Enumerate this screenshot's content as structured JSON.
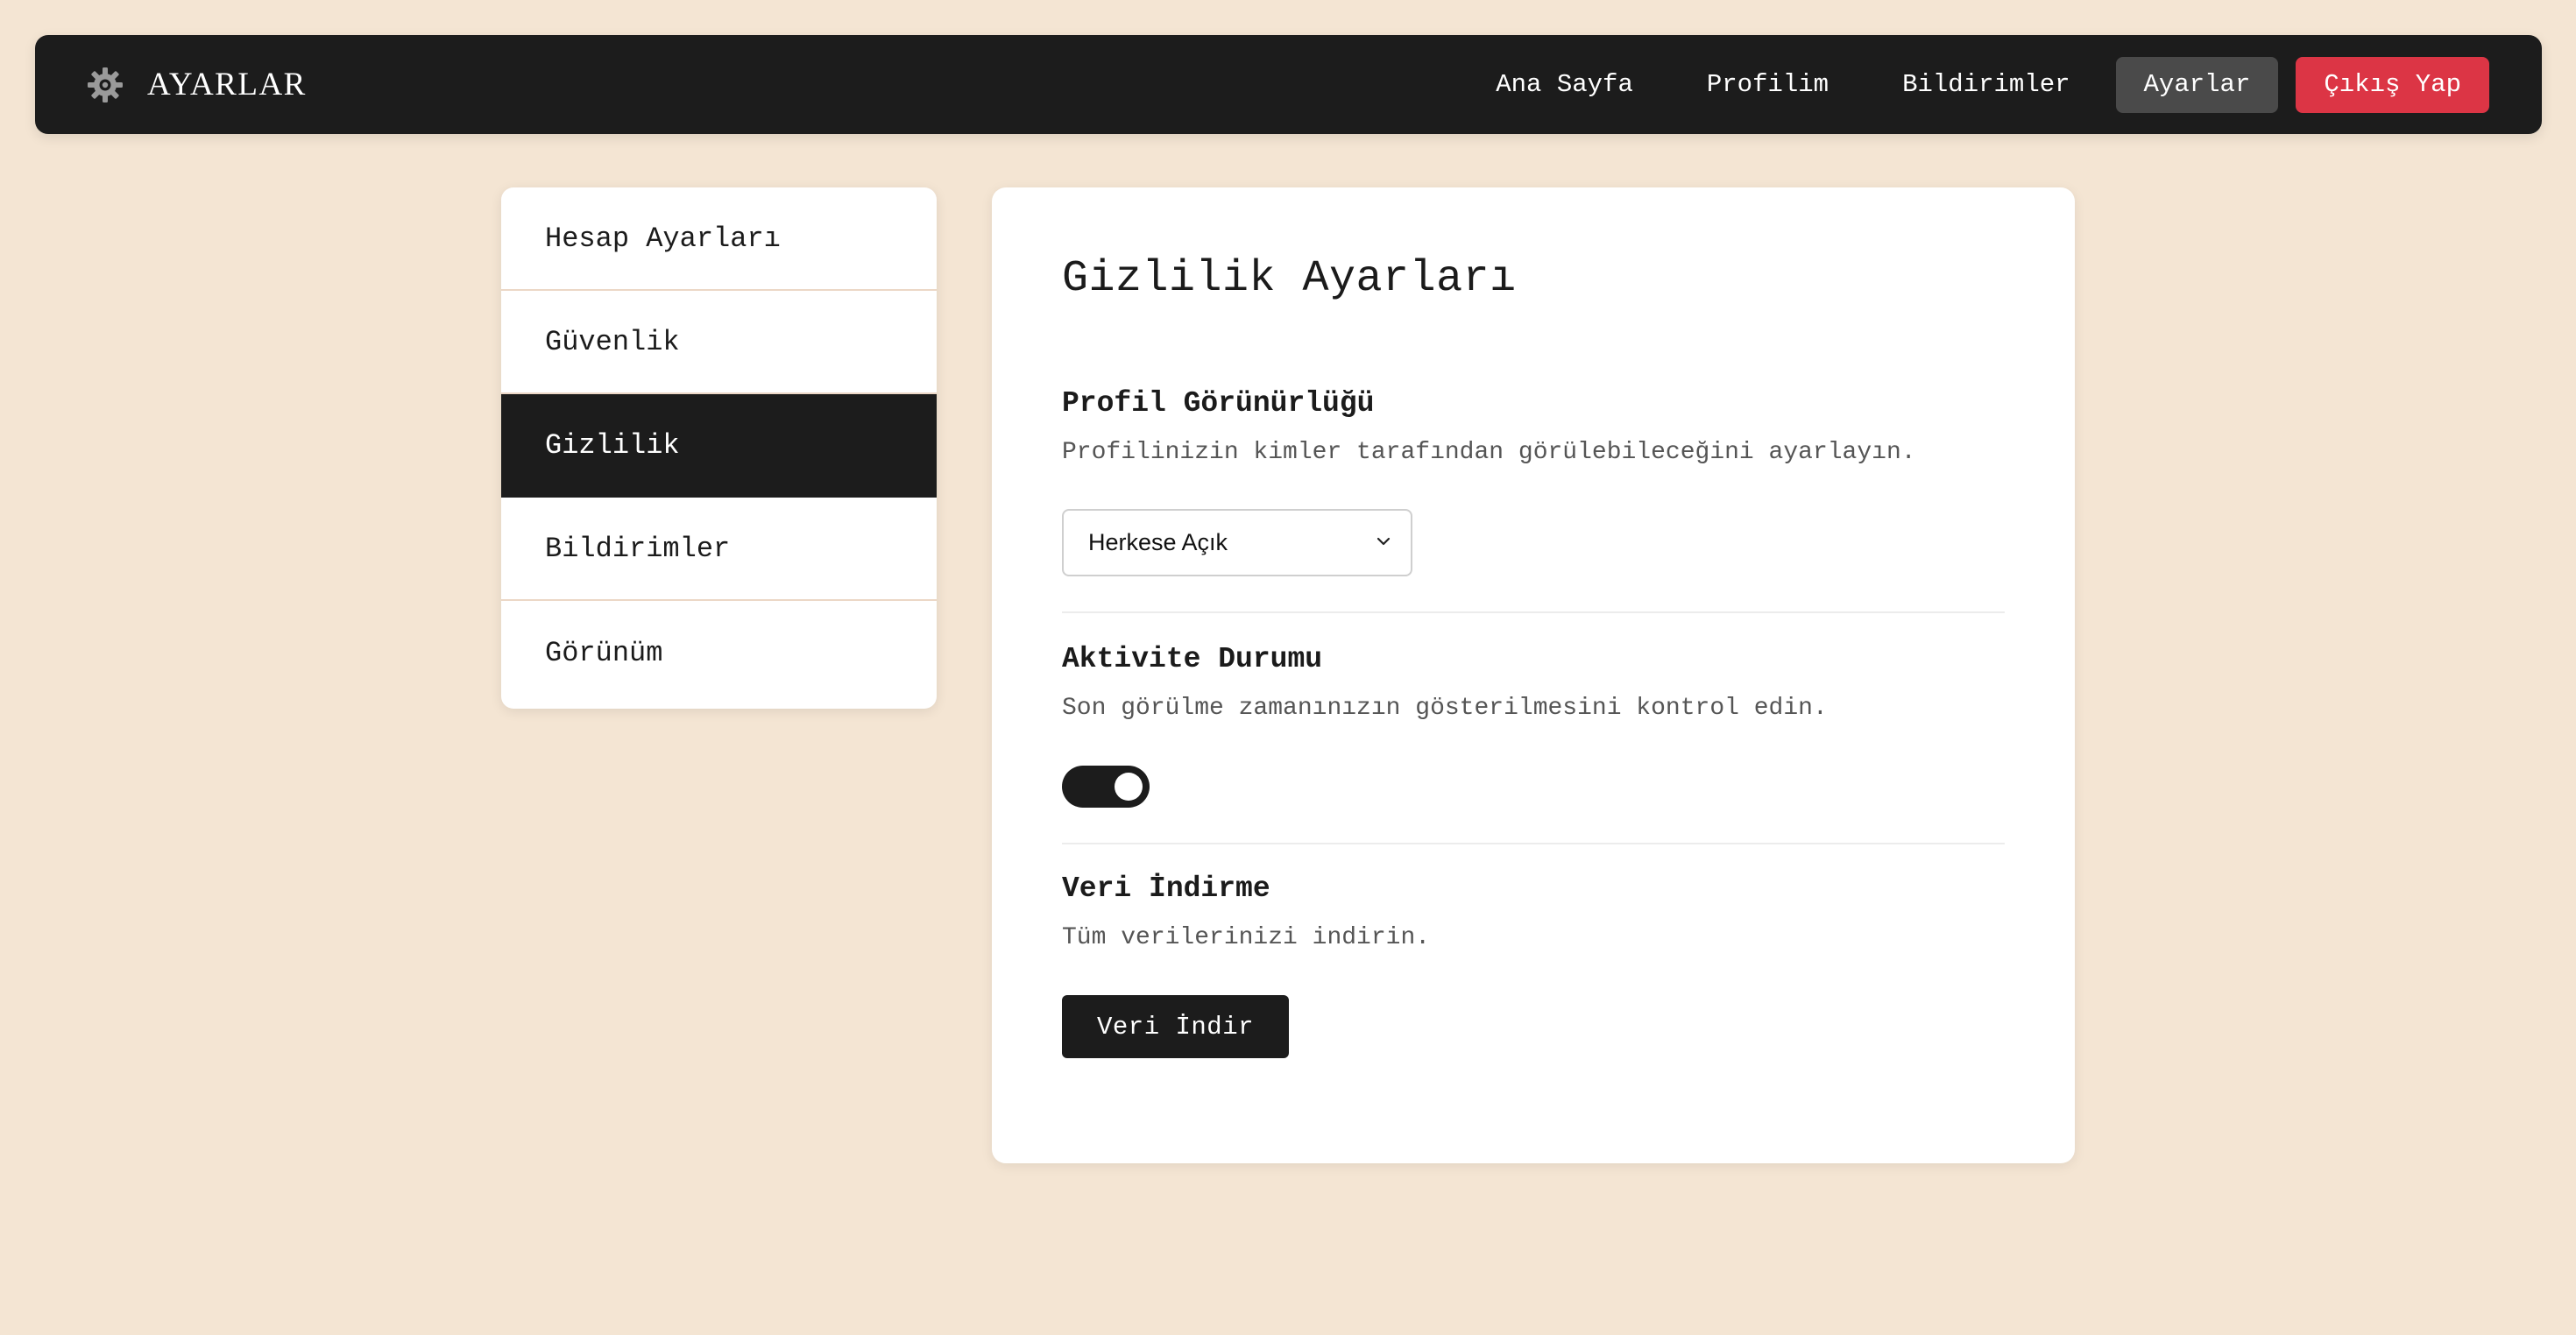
{
  "navbar": {
    "icon": "gear-icon",
    "title": "AYARLAR",
    "links": {
      "home": "Ana Sayfa",
      "profile": "Profilim",
      "notifications": "Bildirimler",
      "settings": "Ayarlar",
      "logout": "Çıkış Yap"
    }
  },
  "sidebar": {
    "items": [
      {
        "label": "Hesap Ayarları"
      },
      {
        "label": "Güvenlik"
      },
      {
        "label": "Gizlilik",
        "active": true
      },
      {
        "label": "Bildirimler"
      },
      {
        "label": "Görünüm"
      }
    ]
  },
  "main": {
    "title": "Gizlilik Ayarları",
    "profile_visibility": {
      "title": "Profil Görünürlüğü",
      "description": "Profilinizin kimler tarafından görülebileceğini ayarlayın.",
      "selected": "Herkese Açık"
    },
    "activity_status": {
      "title": "Aktivite Durumu",
      "description": "Son görülme zamanınızın gösterilmesini kontrol edin.",
      "enabled": true
    },
    "data_download": {
      "title": "Veri İndirme",
      "description": "Tüm verilerinizi indirin.",
      "button": "Veri İndir"
    }
  },
  "colors": {
    "page_background": "#f4e5d3",
    "navbar": "#1c1c1c",
    "active_nav": "#4a4a4a",
    "logout": "#dc3545",
    "accent_dark": "#1c1c1c"
  }
}
